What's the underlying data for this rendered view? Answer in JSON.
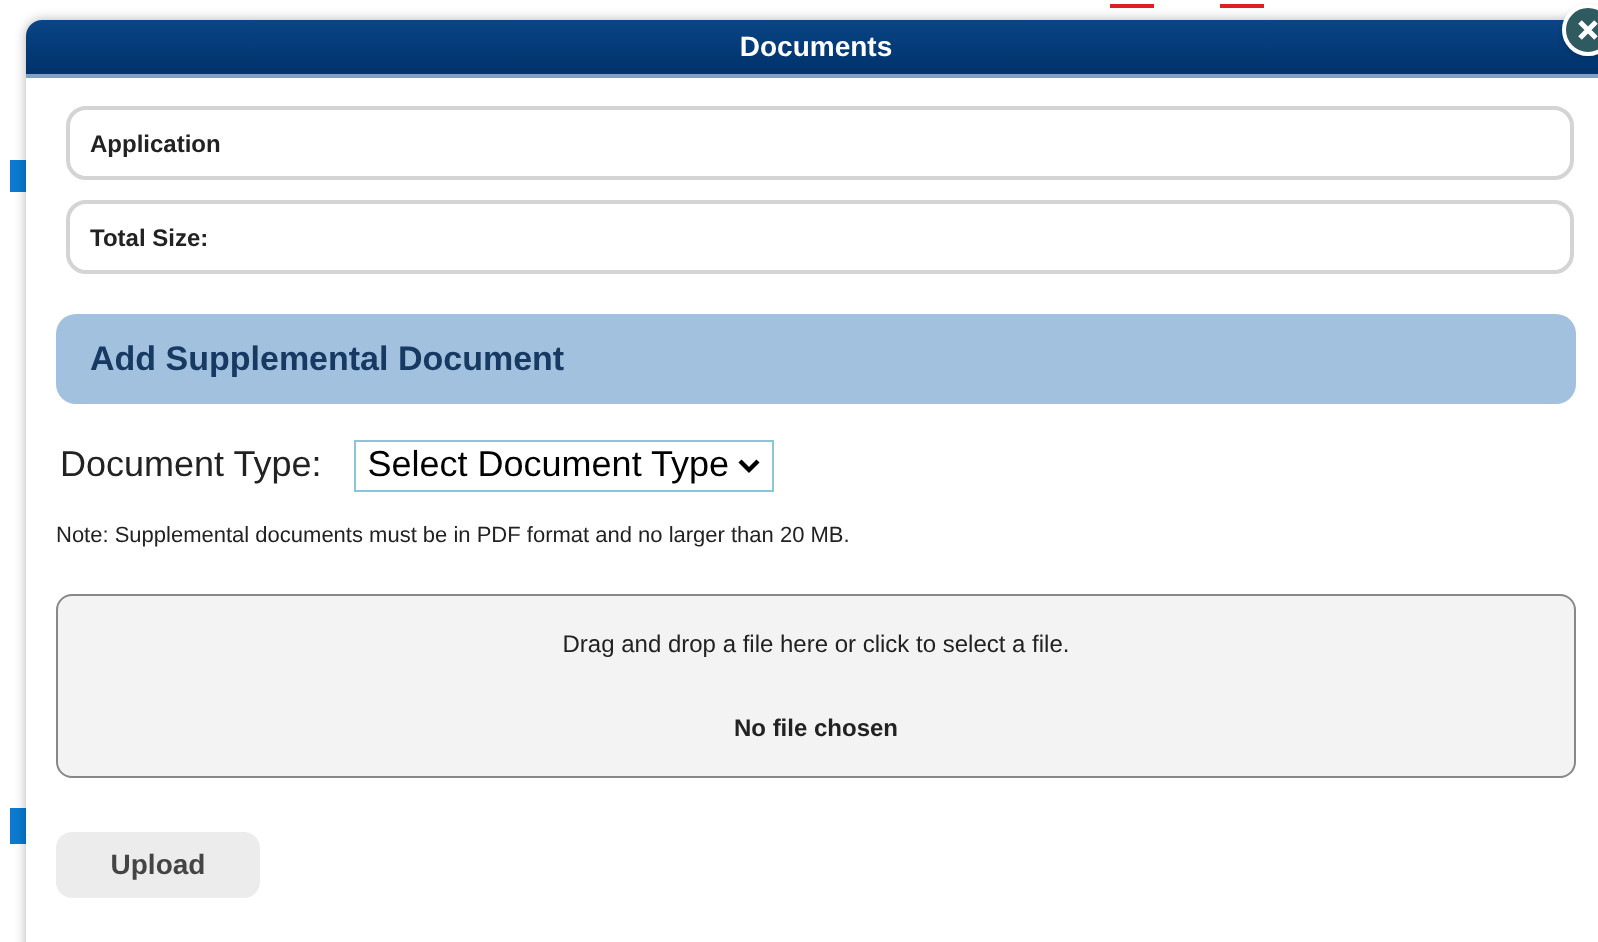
{
  "dialog": {
    "title": "Documents"
  },
  "info_rows": [
    {
      "label": "Application"
    },
    {
      "label": "Total Size:"
    }
  ],
  "section": {
    "title": "Add Supplemental Document"
  },
  "document_type": {
    "label": "Document Type:",
    "value": "Select Document Type"
  },
  "note": "Note: Supplemental documents must be in PDF format and no larger than 20 MB.",
  "drop_zone": {
    "prompt": "Drag and drop a file here or click to select a file.",
    "status": "No file chosen"
  },
  "buttons": [
    {
      "label": "Upload"
    }
  ]
}
